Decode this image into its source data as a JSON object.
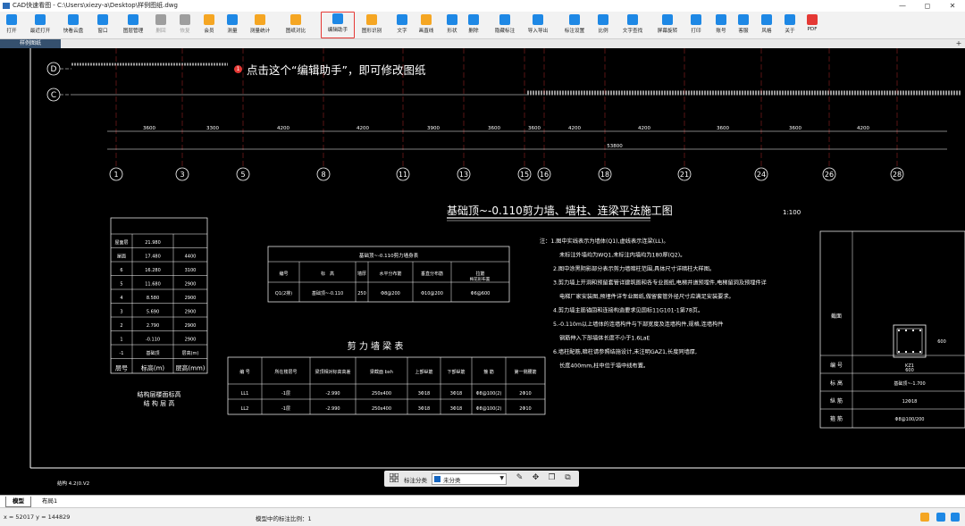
{
  "window": {
    "title": "CAD快速看图 - C:\\Users\\xiezy-a\\Desktop\\样例图纸.dwg",
    "controls": [
      "—",
      "◻",
      "✕"
    ]
  },
  "toolbar": {
    "items": [
      {
        "label": "打开",
        "icon": "folder-icon",
        "color": "#1e88e5"
      },
      {
        "label": "最近打开",
        "icon": "clock-icon",
        "color": "#1e88e5"
      },
      {
        "label": "快看云盘",
        "icon": "cloud-icon",
        "color": "#1e88e5"
      },
      {
        "label": "窗口",
        "icon": "window-icon",
        "color": "#1e88e5"
      },
      {
        "label": "图层管理",
        "icon": "layers-icon",
        "color": "#1e88e5"
      },
      {
        "label": "删回",
        "icon": "undo-icon",
        "color": "#9e9e9e"
      },
      {
        "label": "恢复",
        "icon": "redo-icon",
        "color": "#9e9e9e"
      },
      {
        "label": "会员",
        "icon": "vip-icon",
        "color": "#f5a623"
      },
      {
        "label": "测量",
        "icon": "measure-icon",
        "color": "#1e88e5"
      },
      {
        "label": "测量统计",
        "icon": "measure-stats-icon",
        "color": "#f5a623"
      },
      {
        "label": "图纸对比",
        "icon": "compare-icon",
        "color": "#f5a623"
      },
      {
        "label": "编辑助手",
        "icon": "edit-assistant-icon",
        "color": "#1e88e5"
      },
      {
        "label": "图形识别",
        "icon": "shape-recognition-icon",
        "color": "#f5a623"
      },
      {
        "label": "文字",
        "icon": "text-icon",
        "color": "#1e88e5"
      },
      {
        "label": "画直线",
        "icon": "line-icon",
        "color": "#f5a623"
      },
      {
        "label": "形状",
        "icon": "shape-icon",
        "color": "#1e88e5"
      },
      {
        "label": "删除",
        "icon": "eraser-icon",
        "color": "#1e88e5"
      },
      {
        "label": "隐藏标注",
        "icon": "hide-annotation-icon",
        "color": "#1e88e5"
      },
      {
        "label": "导入导出",
        "icon": "import-export-icon",
        "color": "#1e88e5"
      },
      {
        "label": "标注设置",
        "icon": "annotation-settings-icon",
        "color": "#1e88e5"
      },
      {
        "label": "比例",
        "icon": "scale-icon",
        "color": "#1e88e5"
      },
      {
        "label": "文字查找",
        "icon": "text-search-icon",
        "color": "#1e88e5"
      },
      {
        "label": "屏幕旋转",
        "icon": "rotate-screen-icon",
        "color": "#1e88e5"
      },
      {
        "label": "打印",
        "icon": "print-icon",
        "color": "#1e88e5"
      },
      {
        "label": "账号",
        "icon": "account-icon",
        "color": "#1e88e5"
      },
      {
        "label": "客服",
        "icon": "headset-icon",
        "color": "#1e88e5"
      },
      {
        "label": "风格",
        "icon": "style-icon",
        "color": "#1e88e5"
      },
      {
        "label": "关于",
        "icon": "info-icon",
        "color": "#1e88e5"
      },
      {
        "label": "PDF",
        "icon": "pdf-icon",
        "color": "#e53935"
      }
    ]
  },
  "tabs": {
    "document": "样例图纸",
    "add": "+"
  },
  "callout": {
    "number": "1",
    "text": "点击这个“编辑助手”，即可修改图纸"
  },
  "drawing": {
    "plan_title": "基础顶~-0.110剪力墙、墙柱、连梁平法施工图",
    "plan_scale": "1:100",
    "axis_labels": [
      "D",
      "C",
      "1",
      "3",
      "5",
      "8",
      "11",
      "13",
      "15",
      "16",
      "18",
      "21",
      "24",
      "26",
      "28"
    ],
    "dim_top": [
      "3600",
      "3300",
      "4200",
      "4200",
      "3900",
      "3600",
      "3600",
      "4200",
      "4200",
      "3600",
      "3600",
      "4200"
    ],
    "dim_overall": "53800",
    "shear_wall_title": "剪 力 墙 梁 表",
    "wall_table_title": "基础顶~-0.110剪力墙身表",
    "wall_table_headers": [
      "编号",
      "标　高",
      "墙厚",
      "水平分布筋",
      "垂直分布筋",
      "拉筋",
      "梅花形布置"
    ],
    "wall_table_row": [
      "Q1(2排)",
      "基础顶~-0.110",
      "250",
      "Φ8@200",
      "Φ10@200",
      "Φ6@600"
    ],
    "beam_table_headers": [
      "编 号",
      "所在楼层号",
      "梁顶相对标高高差",
      "梁截面 bxh",
      "上部纵筋",
      "下部纵筋",
      "箍 筋",
      "第一侧腰筋"
    ],
    "beam_rows": [
      [
        "LL1",
        "-1层",
        "-2.990",
        "250x400",
        "3Φ18",
        "3Φ18",
        "Φ8@100(2)",
        "2Φ10"
      ],
      [
        "LL2",
        "-1层",
        "-2.990",
        "250x400",
        "3Φ18",
        "3Φ18",
        "Φ8@100(2)",
        "2Φ10"
      ]
    ],
    "story_table": [
      [
        "屋面层",
        "21.980",
        ""
      ],
      [
        "屋面",
        "17.480",
        "4400"
      ],
      [
        "6",
        "16.280",
        "3100"
      ],
      [
        "5",
        "11.680",
        "2900"
      ],
      [
        "4",
        "8.580",
        "2900"
      ],
      [
        "3",
        "5.690",
        "2900"
      ],
      [
        "2",
        "2.790",
        "2900"
      ],
      [
        "1",
        "-0.110",
        "2900"
      ],
      [
        "-1",
        "基础顶",
        "层高(m)"
      ]
    ],
    "story_table_footer": [
      "层号",
      "标高(m)",
      "层高(mm)"
    ],
    "story_table_caption": [
      "结构层楼面标高",
      "结 构 层 高"
    ],
    "notes": [
      "注：1.图中实线表示为墙体(Q1),虚线表示连梁(LL)。",
      "未标注外墙均为WQ1,未标注内墙均为180厚(Q2)。",
      "2.图中涂黑阴影部分表示剪力墙暗柱范围,具体尺寸详暗柱大样图。",
      "3.剪力墙上开洞和预留套管详建筑图和各专业图纸,电梯井道预埋件,电梯留洞及预埋件详",
      "电梯厂家安装图,预埋件详专业图纸,做留套管外径尺寸应满足安装要求。",
      "4.剪力墙主筋锚固和连接构造要求见国标11G101-1第78页。",
      "5.-0.110m以上墙体的连墙构件与下部宽度及连墙构件,规格,连墙构件",
      "钢筋伸入下部墙体长度不小于1.6LaE",
      "6.墙柱配筋,暗柱请参照结施设计,未注明GAZ1,长度同墙厚,",
      "长度400mm,柱中位于墙中线布置。"
    ],
    "column_table": {
      "section_label": "截面",
      "dim_width": "600",
      "dim_height": "600",
      "rows": [
        [
          "编 号",
          "KZ1"
        ],
        [
          "标 高",
          "基础顶~-1.700"
        ],
        [
          "纵 筋",
          "12Φ18"
        ],
        [
          "箍 筋",
          "Φ8@100/200"
        ]
      ]
    },
    "bottom_note": "结构 4.2(0.V2"
  },
  "floatbar": {
    "label": "标注分类",
    "selected": "未分类",
    "swatch_color": "#1565c0"
  },
  "layout_tabs": [
    "模型",
    "布局1"
  ],
  "status": {
    "coords": "x = 52017  y = 144829",
    "message": "模型中的标注比例：1"
  }
}
